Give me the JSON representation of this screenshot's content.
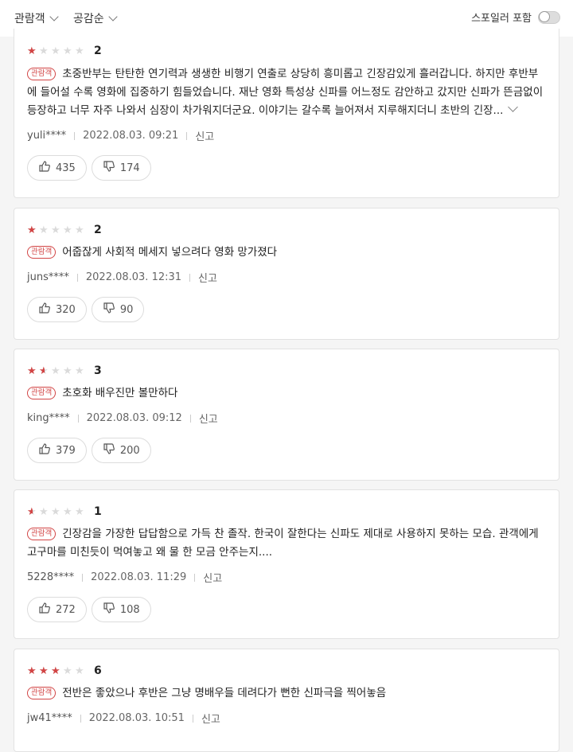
{
  "filters": {
    "audience": "관람객",
    "sort": "공감순"
  },
  "spoiler": {
    "label": "스포일러 포함"
  },
  "badge_label": "관람객",
  "report_label": "신고",
  "reviews": [
    {
      "score": "2",
      "rating": 2,
      "text": "초중반부는 탄탄한 연기력과 생생한 비행기 연출로 상당히 흥미롭고 긴장감있게 흘러갑니다. 하지만 후반부에 들어설 수록 영화에 집중하기 힘들었습니다. 재난 영화 특성상 신파를 어느정도 감안하고 갔지만 신파가 뜬금없이 등장하고 너무 자주 나와서 심장이 차가워지더군요. 이야기는 갈수록 늘어져서 지루해지더니 초반의 긴장...",
      "user": "yuli****",
      "date": "2022.08.03. 09:21",
      "likes": "435",
      "dislikes": "174"
    },
    {
      "score": "2",
      "rating": 2,
      "text": "어줍잖게 사회적 메세지 넣으려다 영화 망가졌다",
      "user": "juns****",
      "date": "2022.08.03. 12:31",
      "likes": "320",
      "dislikes": "90"
    },
    {
      "score": "3",
      "rating": 3,
      "text": "초호화 배우진만 볼만하다",
      "user": "king****",
      "date": "2022.08.03. 09:12",
      "likes": "379",
      "dislikes": "200"
    },
    {
      "score": "1",
      "rating": 1,
      "text": "긴장감을 가장한 답답함으로 가득 찬 졸작. 한국이 잘한다는 신파도 제대로 사용하지 못하는 모습. 관객에게 고구마를 미친듯이 먹여놓고 왜 물 한 모금 안주는지....",
      "user": "5228****",
      "date": "2022.08.03. 11:29",
      "likes": "272",
      "dislikes": "108"
    },
    {
      "score": "6",
      "rating": 6,
      "text": "전반은 좋았으나 후반은 그냥 명배우들 데려다가 뻔한 신파극을 찍어놓음",
      "user": "jw41****",
      "date": "2022.08.03. 10:51",
      "likes": "",
      "dislikes": ""
    }
  ]
}
